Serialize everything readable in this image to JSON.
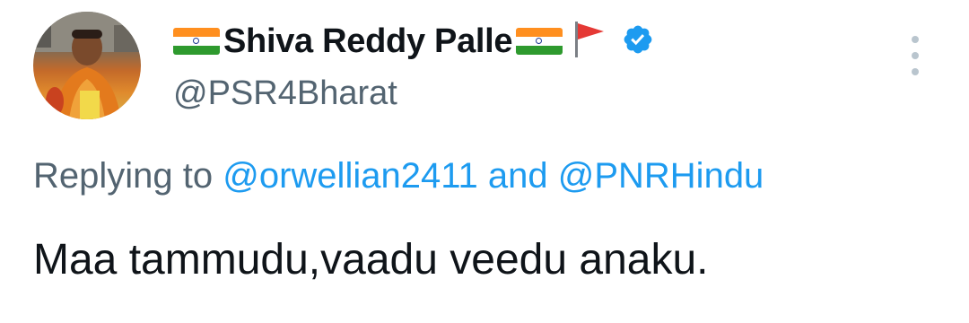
{
  "tweet": {
    "author": {
      "display_name": "Shiva Reddy Palle",
      "handle": "@PSR4Bharat",
      "avatar_icon": "avatar-photo",
      "name_decorations": [
        "india-flag-icon",
        "india-flag-icon",
        "saffron-flag-icon",
        "verified-badge-icon"
      ]
    },
    "reply_prefix": "Replying to",
    "reply_mention_1": "@orwellian2411",
    "reply_conjunction": "and",
    "reply_mention_2": "@PNRHindu",
    "text": "Maa tammudu,vaadu veedu anaku.",
    "more_icon": "more-options-icon"
  },
  "colors": {
    "text": "#0f1419",
    "secondary": "#536471",
    "accent": "#1d9bf0",
    "verified": "#1d9bf0"
  }
}
